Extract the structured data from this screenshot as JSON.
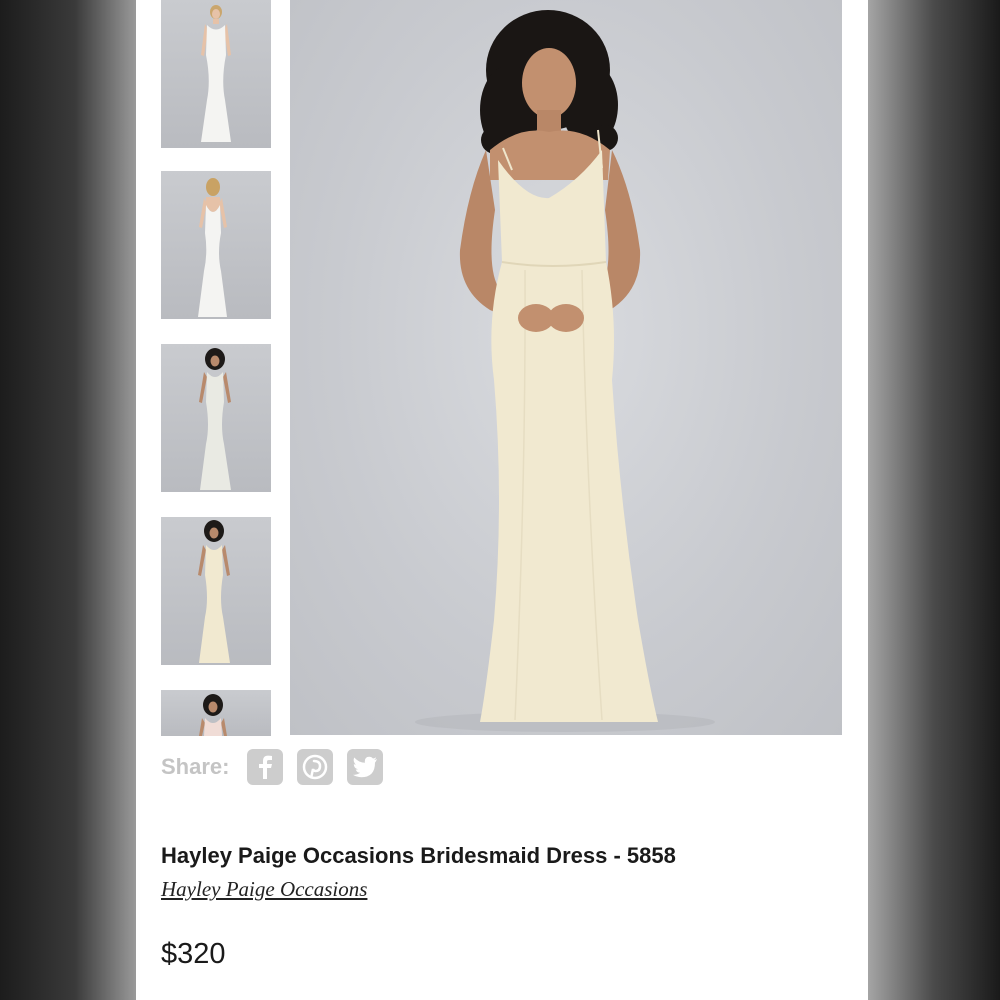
{
  "share": {
    "label": "Share:",
    "icons": [
      "facebook-icon",
      "pinterest-icon",
      "twitter-icon"
    ]
  },
  "product": {
    "title": "Hayley Paige Occasions Bridesmaid Dress - 5858",
    "brand": "Hayley Paige Occasions",
    "price": "$320"
  },
  "gallery": {
    "thumbnails": [
      "white dress front",
      "white dress back",
      "ivory dress front",
      "champagne dress front",
      "blush dress front"
    ],
    "main_image": "champagne dress front"
  },
  "colors": {
    "white_dress": "#f4f4f2",
    "ivory_dress": "#e9eae3",
    "champagne_dress": "#f1e9d0",
    "blush_dress": "#f0dcd6",
    "share_icon_bg": "#cdcdcd",
    "share_label": "#c4c4c4"
  }
}
